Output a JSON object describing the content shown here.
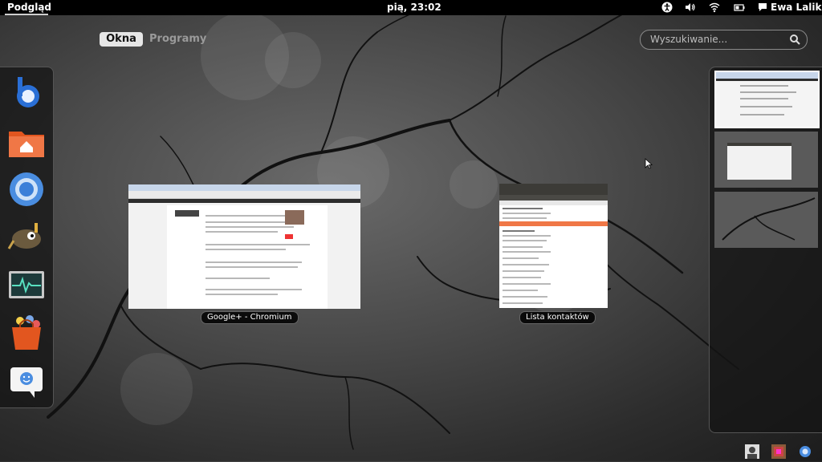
{
  "topbar": {
    "activities_label": "Podgląd",
    "clock": "pią, 23:02",
    "user_name": "Ewa Lalik"
  },
  "view_selector": {
    "tabs": [
      {
        "label": "Okna",
        "active": true
      },
      {
        "label": "Programy",
        "active": false
      }
    ]
  },
  "search": {
    "placeholder": "Wyszukiwanie..."
  },
  "dash": {
    "items": [
      "blueman-icon",
      "home-folder-icon",
      "chromium-icon",
      "gimp-icon",
      "system-monitor-icon",
      "software-center-icon",
      "empathy-chat-icon"
    ]
  },
  "windows": [
    {
      "caption": "Google+ - Chromium"
    },
    {
      "caption": "Lista kontaktów"
    }
  ],
  "colors": {
    "accent": "#f07746",
    "bar": "#000000"
  }
}
